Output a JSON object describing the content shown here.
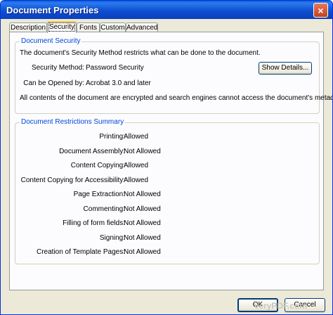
{
  "window": {
    "title": "Document Properties",
    "close_label": "×"
  },
  "tabs": [
    {
      "label": "Description",
      "active": false
    },
    {
      "label": "Security",
      "active": true
    },
    {
      "label": "Fonts",
      "active": false
    },
    {
      "label": "Custom",
      "active": false
    },
    {
      "label": "Advanced",
      "active": false
    }
  ],
  "security": {
    "group_title": "Document Security",
    "intro": "The document's Security Method restricts what can be done to the document.",
    "method_label": "Security Method:",
    "method_value": "Password Security",
    "show_details_label": "Show Details...",
    "opened_by_label": "Can be Opened by:",
    "opened_by_value": "Acrobat 3.0 and later",
    "note": "All contents of the document are encrypted and search engines cannot access the document's metadata."
  },
  "restrictions": {
    "group_title": "Document Restrictions Summary",
    "items": [
      {
        "label": "Printing:",
        "value": "Allowed"
      },
      {
        "label": "Document Assembly:",
        "value": "Not Allowed"
      },
      {
        "label": "Content Copying:",
        "value": "Allowed"
      },
      {
        "label": "Content Copying for Accessibility:",
        "value": "Allowed"
      },
      {
        "label": "Page Extraction:",
        "value": "Not Allowed"
      },
      {
        "label": "Commenting:",
        "value": "Not Allowed"
      },
      {
        "label": "Filling of form fields:",
        "value": "Not Allowed"
      },
      {
        "label": "Signing:",
        "value": "Not Allowed"
      },
      {
        "label": "Creation of Template Pages:",
        "value": "Not Allowed"
      }
    ]
  },
  "footer": {
    "ok_label": "OK",
    "cancel_label": "Cancel",
    "watermark": "VeryPDF.com"
  }
}
